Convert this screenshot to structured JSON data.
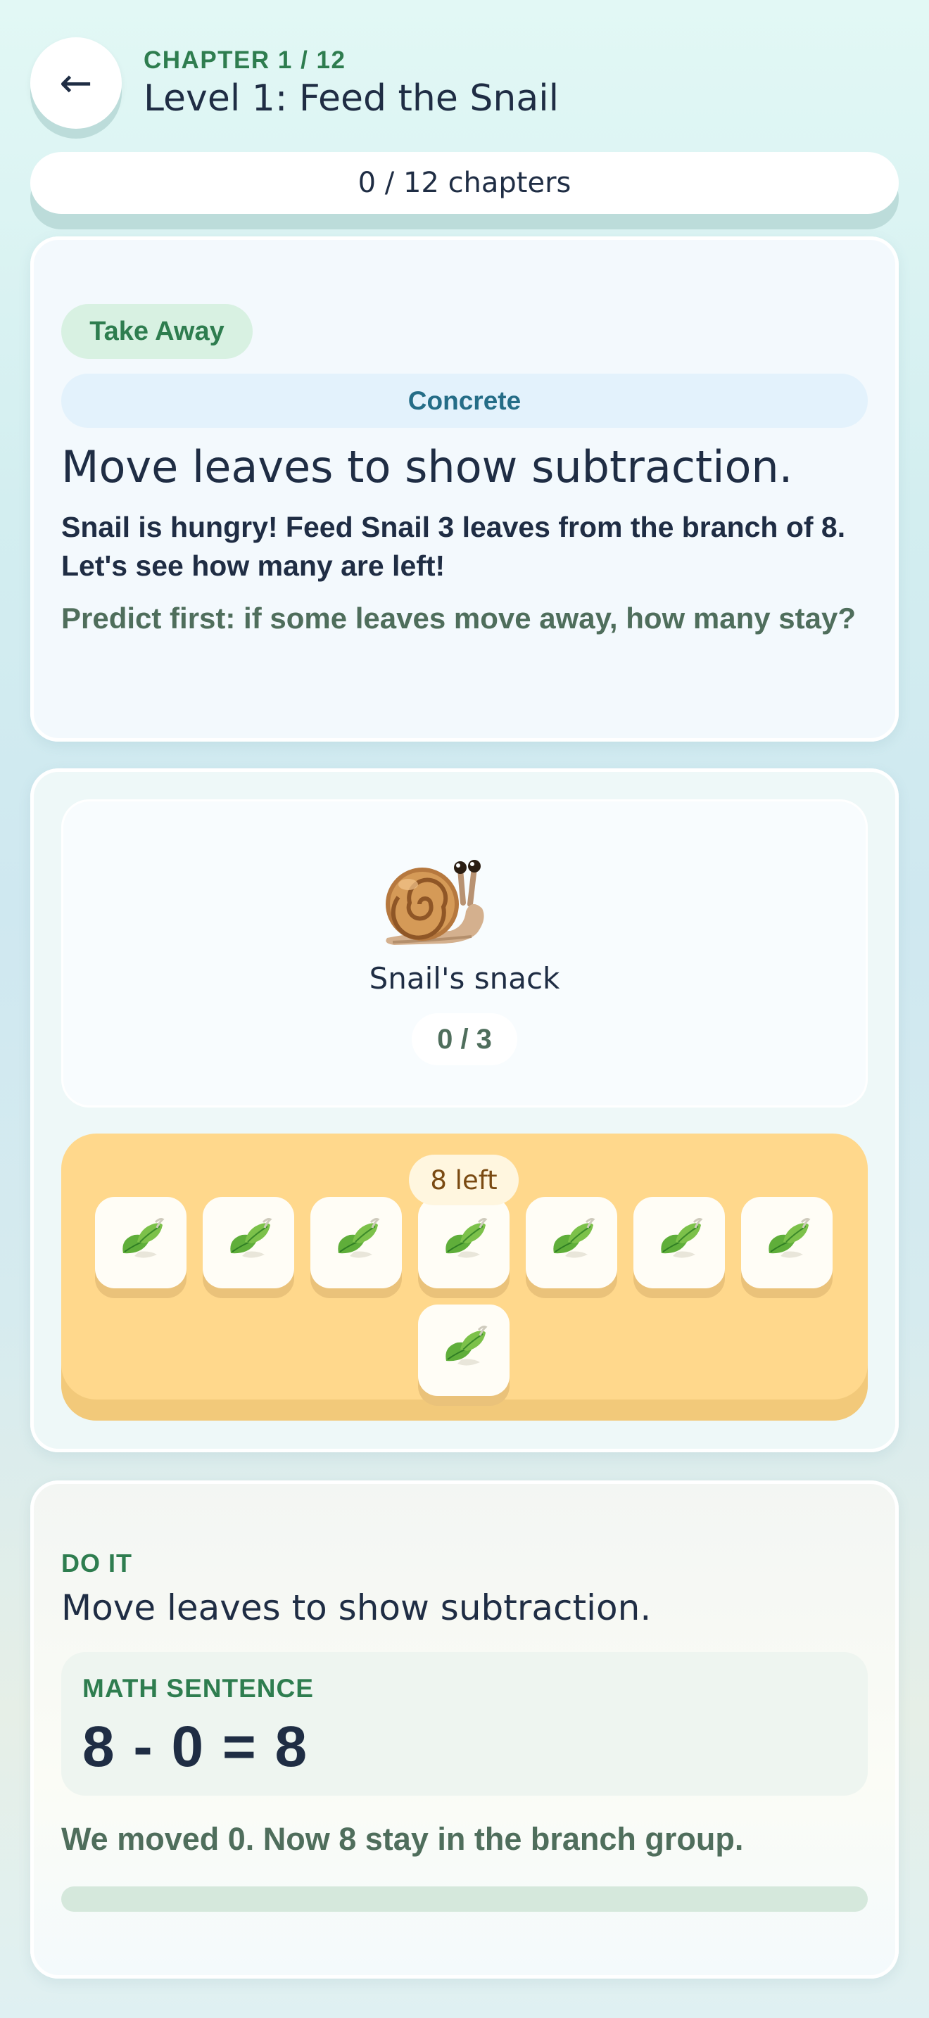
{
  "header": {
    "back_icon": "←",
    "chapter_label": "CHAPTER 1 / 12",
    "title": "Level 1: Feed the Snail",
    "chapters_progress": "0 / 12 chapters"
  },
  "lesson": {
    "tag": "Take Away",
    "mode": "Concrete",
    "headline": "Move leaves to show subtraction.",
    "story": "Snail is hungry! Feed Snail 3 leaves from the branch of 8. Let's see how many are left!",
    "prediction": "Predict first: if some leaves move away, how many stay?"
  },
  "activity": {
    "snail_icon": "snail-icon",
    "snail_label": "Snail's snack",
    "snail_count": "0 / 3",
    "leaves_left_label": "8 left",
    "leaf_icon": "leaf-icon",
    "leaves": [
      {
        "name": "leaf-1"
      },
      {
        "name": "leaf-2"
      },
      {
        "name": "leaf-3"
      },
      {
        "name": "leaf-4"
      },
      {
        "name": "leaf-5"
      },
      {
        "name": "leaf-6"
      },
      {
        "name": "leaf-7"
      },
      {
        "name": "leaf-8"
      }
    ]
  },
  "do_it": {
    "eyebrow": "DO IT",
    "title": "Move leaves to show subtraction.",
    "sentence_label": "MATH SENTENCE",
    "sentence": "8 - 0 = 8",
    "result": "We moved 0. Now 8 stay in the branch group.",
    "progress_fraction": 0
  },
  "colors": {
    "accent_green": "#2e7d4f",
    "text_dark": "#1f2d44",
    "muted_green": "#4f6e5c",
    "branch_yellow": "#ffd88c",
    "mode_blue": "#256d87"
  }
}
